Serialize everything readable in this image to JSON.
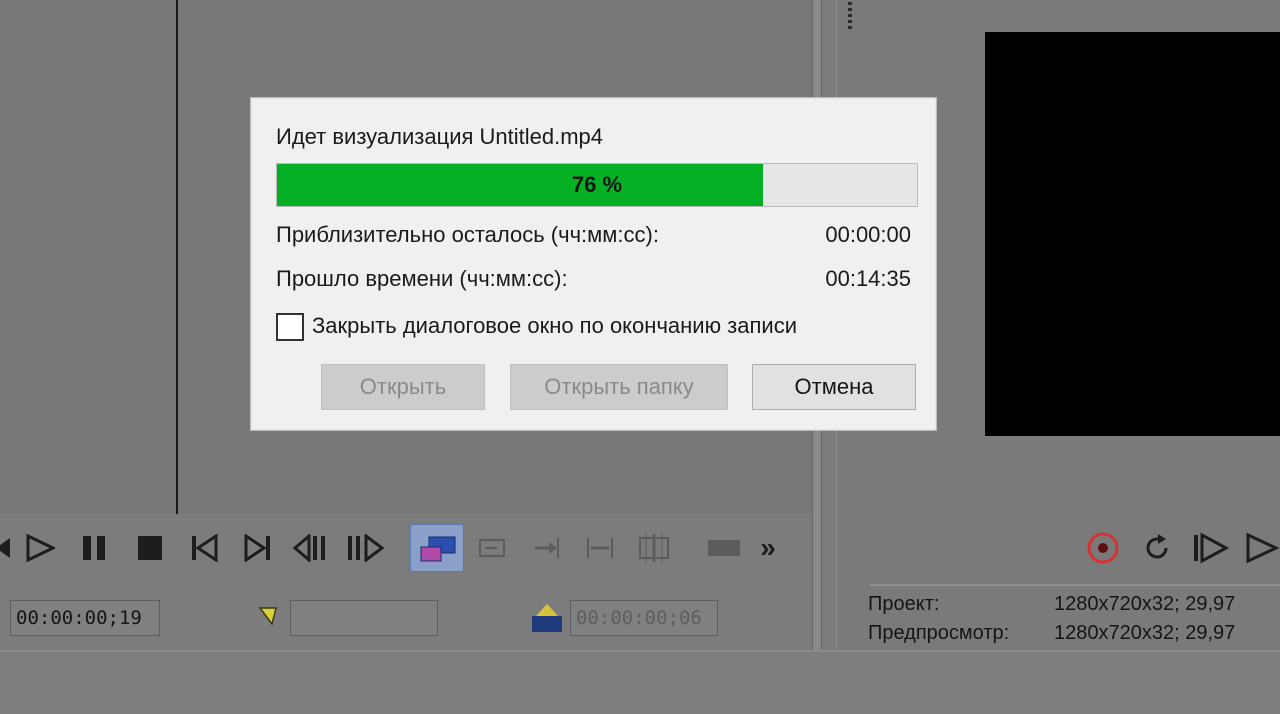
{
  "dialog": {
    "title": "Идет визуализация Untitled.mp4",
    "progress_percent": 76,
    "progress_label": "76 %",
    "remaining_label": "Приблизительно осталось (чч:мм:сс):",
    "remaining_value": "00:00:00",
    "elapsed_label": "Прошло времени (чч:мм:сс):",
    "elapsed_value": "00:14:35",
    "close_checkbox_label": "Закрыть диалоговое окно по окончанию записи",
    "close_checkbox_checked": false,
    "buttons": {
      "open": "Открыть",
      "open_folder": "Открыть папку",
      "cancel": "Отмена"
    },
    "progress_color": "#06b025"
  },
  "transport": {
    "timecode_current": "00:00:00;19",
    "selection_start": "",
    "selection_length": "00:00:00;06",
    "more_glyph": "»",
    "icons": [
      "play-icon",
      "pause-icon",
      "stop-icon",
      "prev-frame-icon",
      "next-frame-icon",
      "prev-marker-icon",
      "next-marker-icon",
      "loop-icon",
      "snap-icon",
      "snap-right-icon",
      "ripple-icon",
      "split-icon",
      "clip-icon",
      "more-icon"
    ]
  },
  "preview": {
    "project_label": "Проект:",
    "project_value": "1280x720x32; 29,97",
    "preview_label": "Предпросмотр:",
    "preview_value": "1280x720x32; 29,97",
    "icons": [
      "record-icon",
      "refresh-icon",
      "step-forward-icon",
      "play-preview-icon"
    ]
  }
}
